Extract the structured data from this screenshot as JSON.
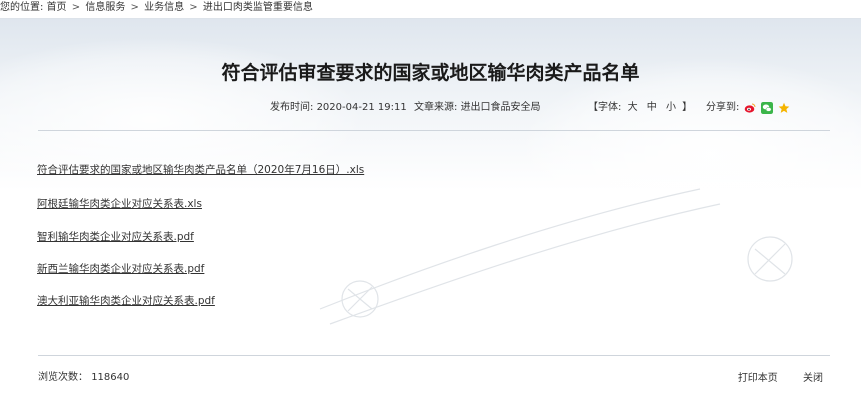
{
  "breadcrumb": {
    "prefix": "您的位置:",
    "items": [
      "首页",
      "信息服务",
      "业务信息",
      "进出口肉类监管重要信息"
    ],
    "separator": ">"
  },
  "article": {
    "title": "符合评估审查要求的国家或地区输华肉类产品名单",
    "publish_label": "发布时间:",
    "publish_time": "2020-04-21 19:11",
    "source_label": "文章来源:",
    "source": "进出口食品安全局",
    "fontsize_label": "【字体:",
    "fontsize_options": [
      "大",
      "中",
      "小"
    ],
    "fontsize_close": "】",
    "share_label": "分享到:",
    "share_icons": [
      "weibo-icon",
      "wechat-icon",
      "favorite-star-icon"
    ]
  },
  "files": [
    "符合评估要求的国家或地区输华肉类产品名单（2020年7月16日）.xls",
    "阿根廷输华肉类企业对应关系表.xls",
    "智利输华肉类企业对应关系表.pdf",
    "新西兰输华肉类企业对应关系表.pdf",
    "澳大利亚输华肉类企业对应关系表.pdf"
  ],
  "footer": {
    "views_label": "浏览次数：",
    "views_count": "118640",
    "print_label": "打印本页",
    "close_label": "关闭"
  },
  "colors": {
    "weibo": "#e6162d",
    "wechat": "#3bb54a",
    "star": "#f5b400"
  }
}
